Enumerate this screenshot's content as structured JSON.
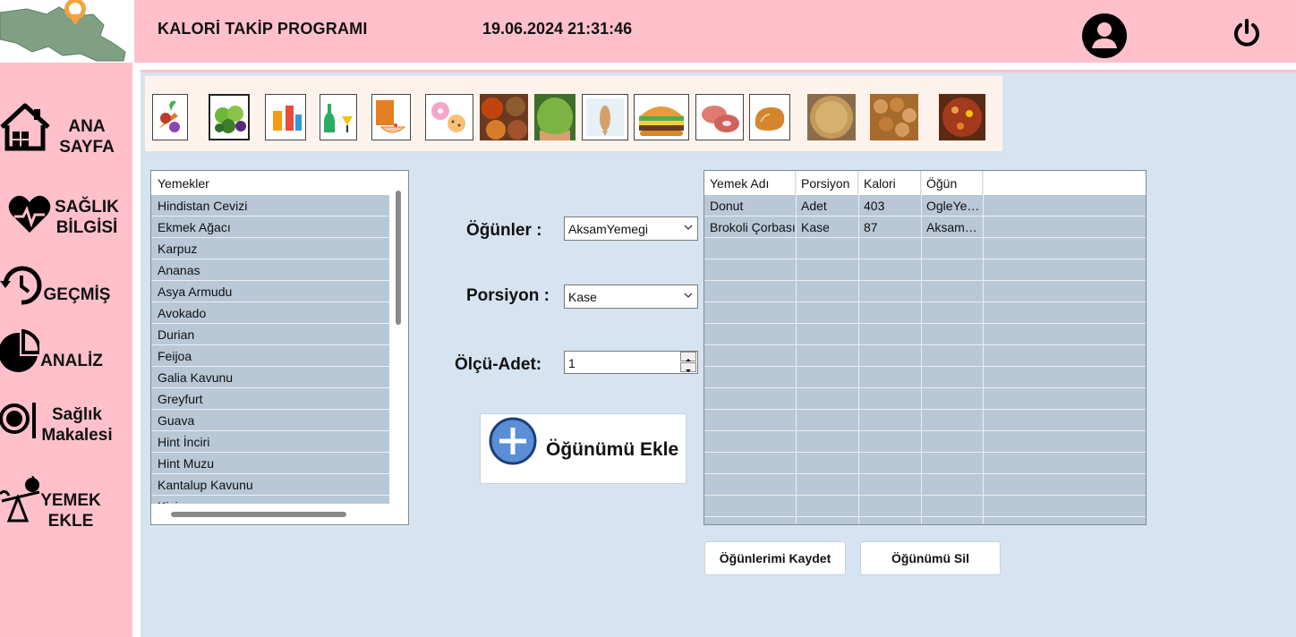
{
  "header": {
    "title": "KALORİ TAKİP PROGRAMI",
    "datetime": "19.06.2024 21:31:46",
    "user_icon": "user-circle-icon",
    "power_icon": "power-icon"
  },
  "sidebar": {
    "items": [
      {
        "label": "ANA\nSAYFA",
        "icon": "home-icon"
      },
      {
        "label": "SAĞLIK\nBİLGİSİ",
        "icon": "heart-pulse-icon"
      },
      {
        "label": "GEÇMİŞ",
        "icon": "history-icon"
      },
      {
        "label": "ANALİZ",
        "icon": "analysis-icon"
      },
      {
        "label": "Sağlık\nMakalesi",
        "icon": "plate-icon"
      },
      {
        "label": "YEMEK\nEKLE",
        "icon": "scale-food-icon"
      }
    ]
  },
  "categories": [
    "vegetables-icon",
    "fruits-icon",
    "drinks-icon",
    "alcohol-icon",
    "cereal-icon",
    "snacks-icon",
    "spices-icon",
    "legumes-icon",
    "fish-icon",
    "fastfood-icon",
    "meat-icon",
    "bread-icon",
    "soup-icon",
    "nuts-icon",
    "dishes-icon"
  ],
  "foods": {
    "header": "Yemekler",
    "items": [
      "Hindistan Cevizi",
      "Ekmek Ağacı",
      "Karpuz",
      "Ananas",
      "Asya Armudu",
      "Avokado",
      "Durian",
      "Feijoa",
      "Galia Kavunu",
      "Greyfurt",
      "Guava",
      "Hint İnciri",
      "Hint Muzu",
      "Kantalup Kavunu",
      "Kivi"
    ]
  },
  "form": {
    "meals_label": "Öğünler :",
    "meals_value": "AksamYemegi",
    "portion_label": "Porsiyon :",
    "portion_value": "Kase",
    "qty_label": "Ölçü-Adet:",
    "qty_value": "1",
    "add_button": "Öğünümü Ekle"
  },
  "meal_table": {
    "columns": [
      "Yemek Adı",
      "Porsiyon",
      "Kalori",
      "Öğün"
    ],
    "rows": [
      [
        "Donut",
        "Adet",
        "403",
        "OgleYemegi"
      ],
      [
        "Brokoli Çorbası",
        "Kase",
        "87",
        "AksamYemegi"
      ]
    ]
  },
  "buttons": {
    "save": "Öğünlerimi Kaydet",
    "delete": "Öğünümü Sil"
  },
  "colors": {
    "header_bg": "#ffc0cb",
    "main_bg": "#d6e3f0",
    "row_bg": "#b8c8d6"
  }
}
